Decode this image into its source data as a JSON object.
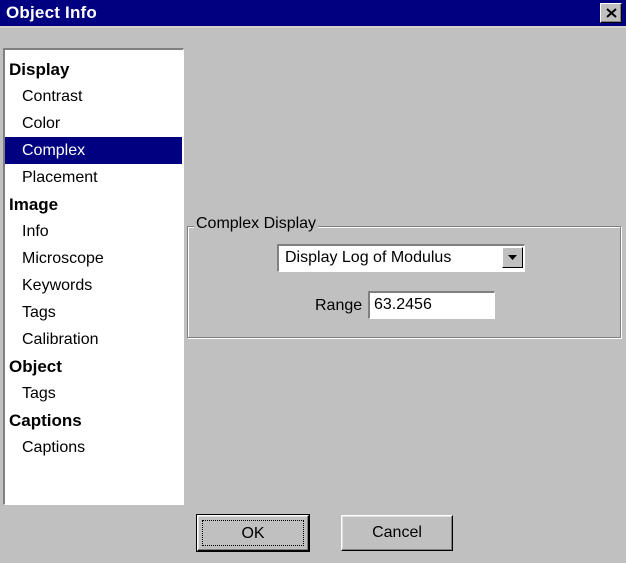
{
  "window": {
    "title": "Object Info"
  },
  "nav": {
    "items": [
      {
        "label": "Display",
        "level": "header"
      },
      {
        "label": "Contrast",
        "level": "sub"
      },
      {
        "label": "Color",
        "level": "sub"
      },
      {
        "label": "Complex",
        "level": "sub",
        "selected": true
      },
      {
        "label": "Placement",
        "level": "sub"
      },
      {
        "label": "Image",
        "level": "header"
      },
      {
        "label": "Info",
        "level": "sub"
      },
      {
        "label": "Microscope",
        "level": "sub"
      },
      {
        "label": "Keywords",
        "level": "sub"
      },
      {
        "label": "Tags",
        "level": "sub"
      },
      {
        "label": "Calibration",
        "level": "sub"
      },
      {
        "label": "Object",
        "level": "header"
      },
      {
        "label": "Tags",
        "level": "sub"
      },
      {
        "label": "Captions",
        "level": "header"
      },
      {
        "label": "Captions",
        "level": "sub"
      }
    ]
  },
  "complex_display": {
    "group_label": "Complex Display",
    "mode_selected": "Display Log of Modulus",
    "range_label": "Range",
    "range_value": "63.2456"
  },
  "buttons": {
    "ok": "OK",
    "cancel": "Cancel"
  },
  "icons": {
    "close": "close-icon",
    "dropdown": "chevron-down-icon"
  },
  "colors": {
    "titlebar": "#000080",
    "selection": "#000080",
    "face": "#c0c0c0"
  }
}
